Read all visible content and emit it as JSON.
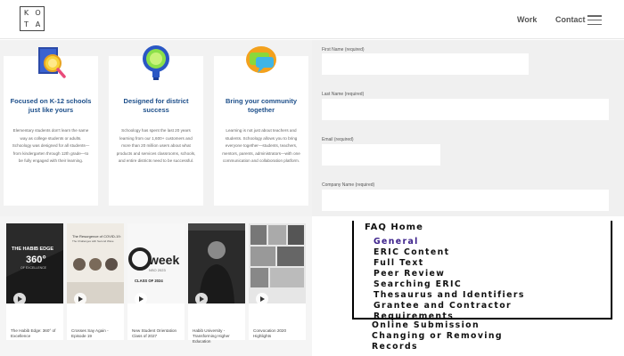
{
  "header": {
    "logo_letters": [
      "K",
      "O",
      "T",
      "A"
    ],
    "nav_work": "Work",
    "nav_contact": "Contact"
  },
  "cards": [
    {
      "icon": "magnifier-book-icon",
      "title": "Focused on K-12 schools just like yours",
      "text": "Elementary students don't learn the same way as college students or adults. Schoology was designed for all students—from kindergarten through 12th grade—to be fully engaged with their learning."
    },
    {
      "icon": "lightbulb-icon",
      "title": "Designed for district success",
      "text": "Schoology has spent the last 20 years learning from our 1,600+ customers and more than 20 million users about what products and services classrooms, schools, and entire districts need to be successful."
    },
    {
      "icon": "chat-bubbles-icon",
      "title": "Bring your community together",
      "text": "Learning is not just about teachers and students. Schoology allows you to bring everyone together—students, teachers, mentors, parents, administrators—with one communication and collaboration platform."
    }
  ],
  "form": {
    "first_name_label": "First Name (required)",
    "last_name_label": "Last Name (required)",
    "email_label": "Email (required)",
    "company_label": "Company Name (required)"
  },
  "videos": [
    {
      "thumb_text": "THE HABIB EDGE 360° OF EXCELLENCE",
      "caption": "The Habib Edge: 360° of Excellence"
    },
    {
      "thumb_text": "The Resurgence of COVID-19: The Challenges with Second Wave",
      "caption": "Crosses Say Again - Episode 19"
    },
    {
      "thumb_text": "Oweek NSO 2023 CLASS OF 2024",
      "caption": "New Student Orientation Class of 2027"
    },
    {
      "thumb_text": "",
      "caption": "Habib University - Transforming Higher Education"
    },
    {
      "thumb_text": "",
      "caption": "Convocation 2020 Highlights"
    }
  ],
  "faq": {
    "heading": "FAQ Home",
    "items": [
      {
        "label": "General",
        "active": true
      },
      {
        "label": "ERIC Content",
        "active": false
      },
      {
        "label": "Full Text",
        "active": false
      },
      {
        "label": "Peer Review",
        "active": false
      },
      {
        "label": "Searching ERIC",
        "active": false
      },
      {
        "label": "Thesaurus and Identifiers",
        "active": false
      },
      {
        "label": "Grantee and Contractor",
        "active": false
      },
      {
        "label": "Requirements",
        "active": false
      }
    ],
    "more_items": [
      "Online Submission",
      "Changing or Removing",
      "Records"
    ]
  },
  "colors": {
    "card_title": "#1d4f8a",
    "faq_active": "#3a1f8a"
  }
}
